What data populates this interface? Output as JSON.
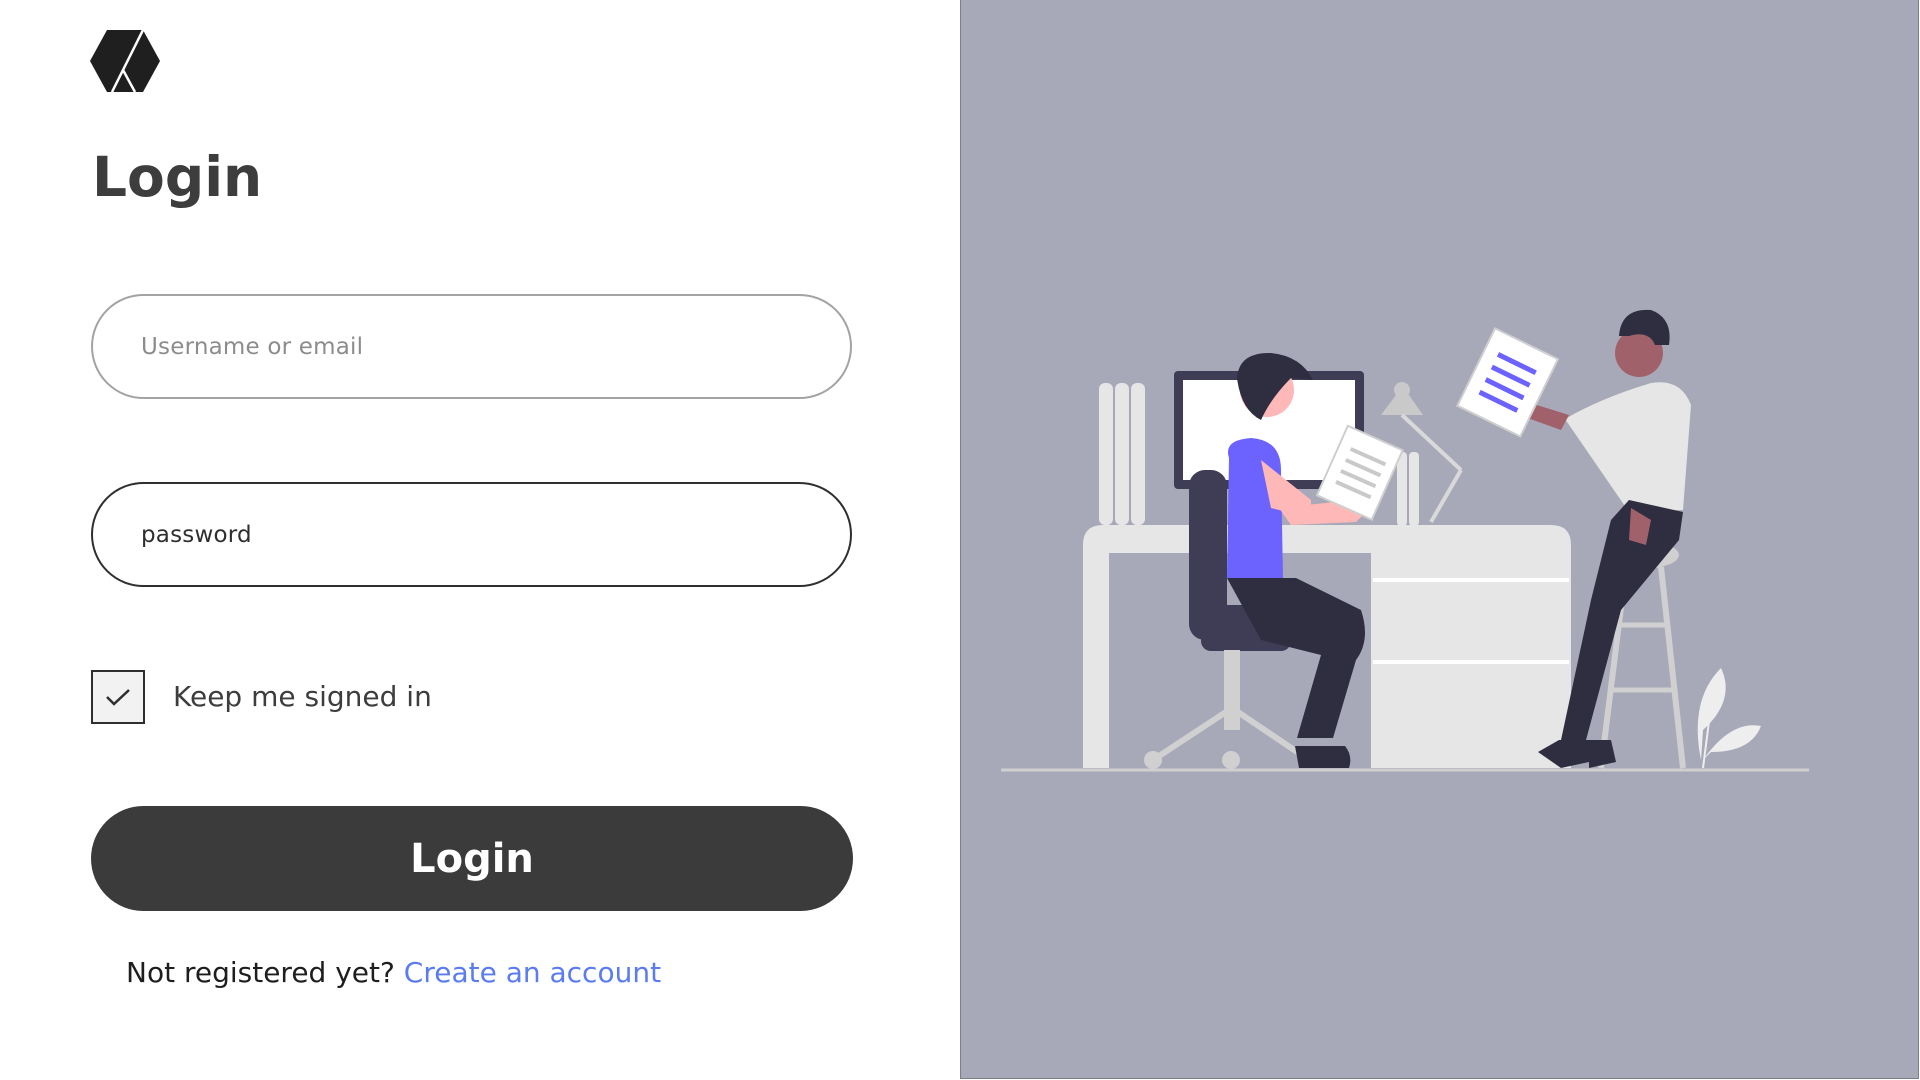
{
  "brand": {
    "logo_icon": "hexagon-logo-icon"
  },
  "login": {
    "title": "Login",
    "username_placeholder": "Username or email",
    "password_value": "password",
    "keep_signed_in_label": "Keep me signed in",
    "keep_signed_in_checked": true,
    "submit_label": "Login",
    "register_prompt": "Not registered yet?",
    "register_link": "Create an account"
  },
  "illustration": {
    "name": "office-collaboration-illustration"
  },
  "colors": {
    "background": "#ffffff",
    "panel": "#a8a9b8",
    "primary_button": "#3b3b3b",
    "link": "#5b7cf0",
    "accent": "#6c63ff"
  }
}
